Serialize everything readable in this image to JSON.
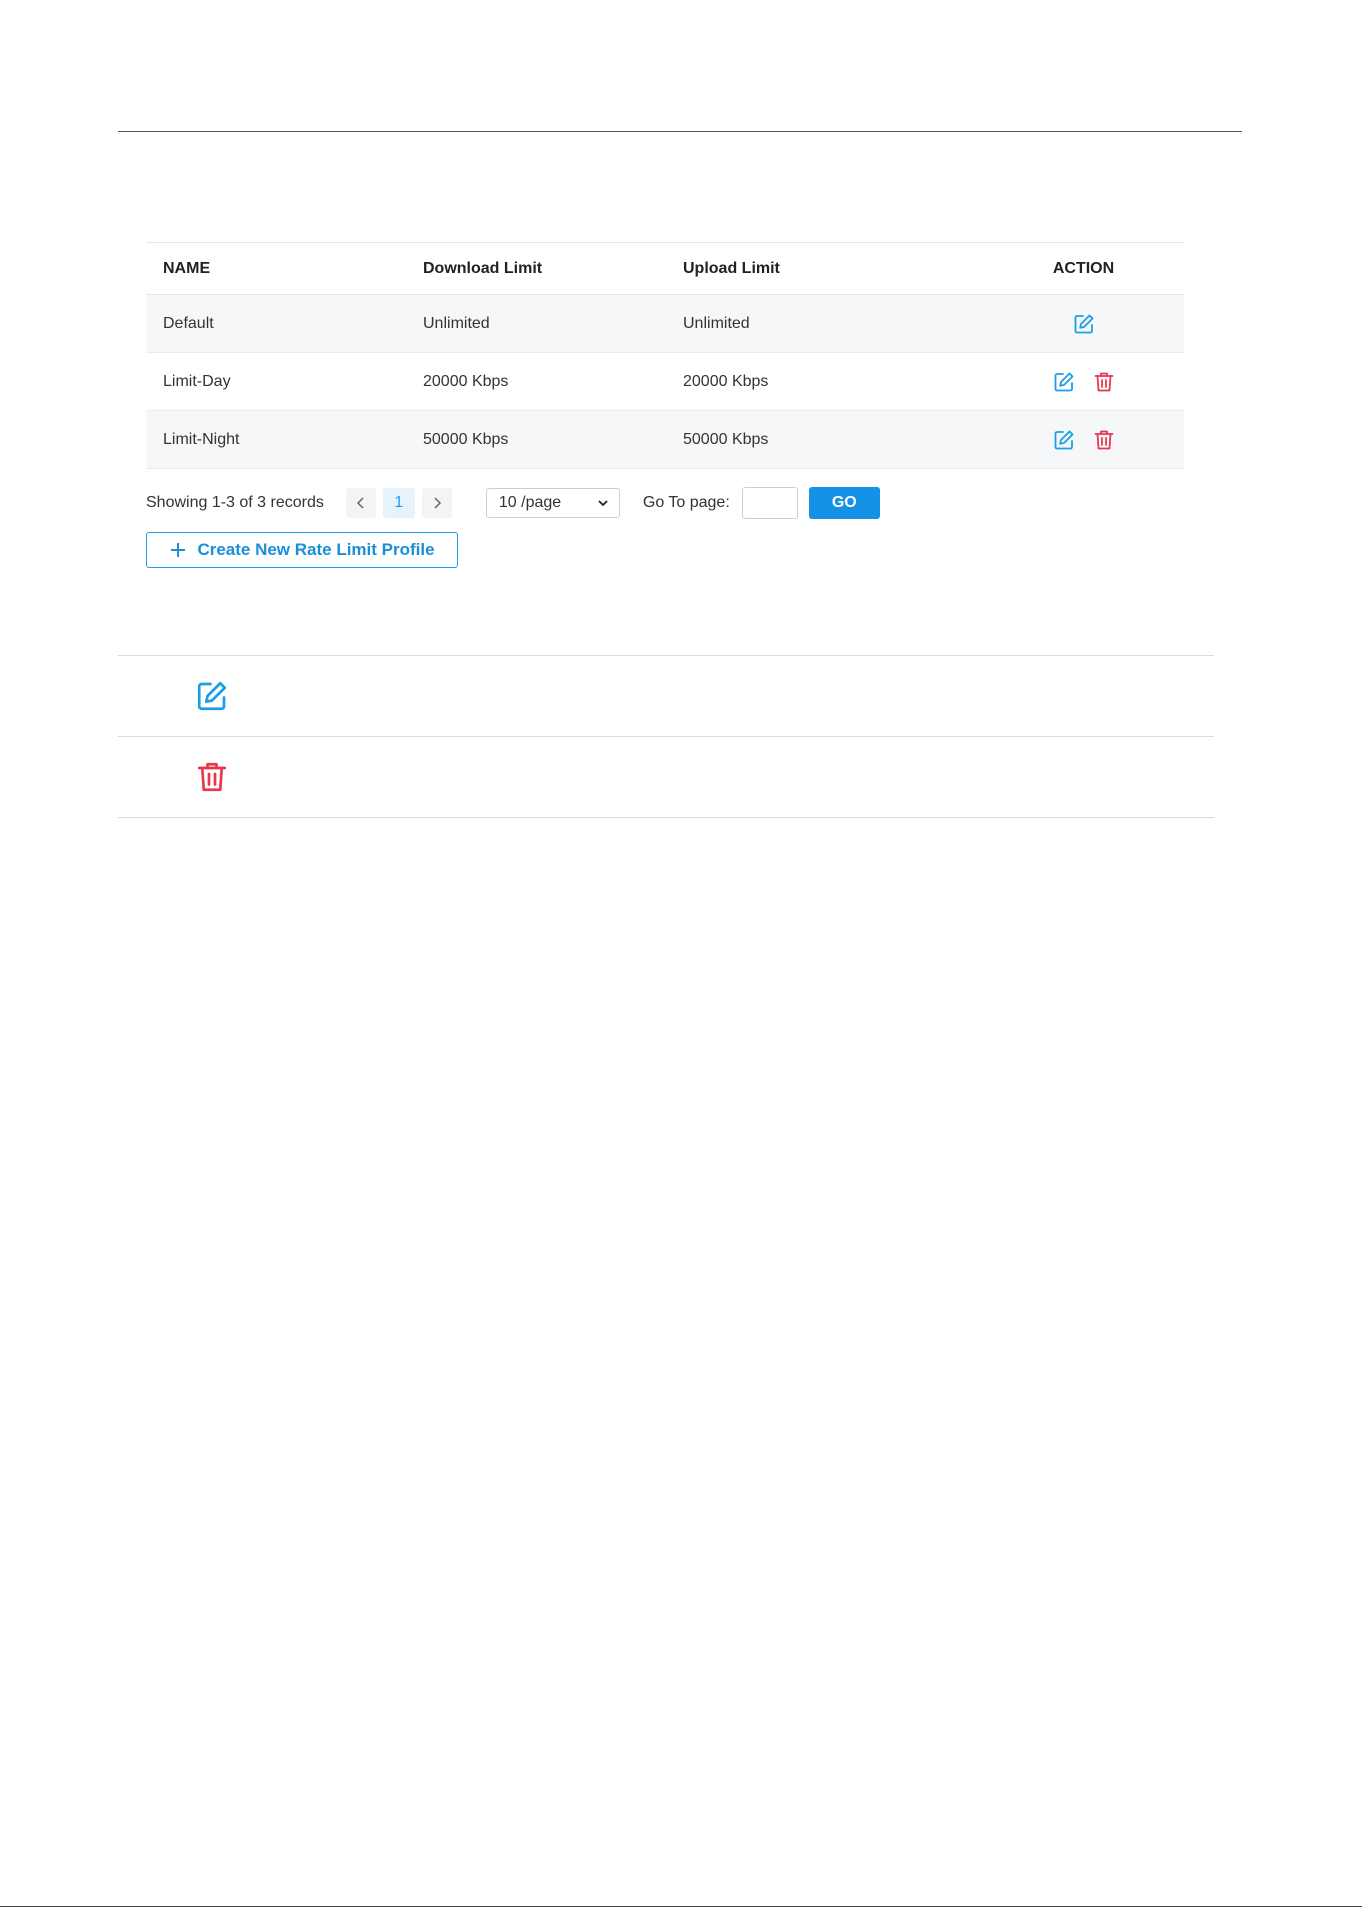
{
  "table": {
    "headers": {
      "name": "NAME",
      "download": "Download Limit",
      "upload": "Upload Limit",
      "action": "ACTION"
    },
    "rows": [
      {
        "name": "Default",
        "download": "Unlimited",
        "upload": "Unlimited",
        "actions": [
          "edit-icon"
        ]
      },
      {
        "name": "Limit-Day",
        "download": "20000 Kbps",
        "upload": "20000 Kbps",
        "actions": [
          "edit-icon",
          "delete-icon"
        ]
      },
      {
        "name": "Limit-Night",
        "download": "50000 Kbps",
        "upload": "50000 Kbps",
        "actions": [
          "edit-icon",
          "delete-icon"
        ]
      }
    ]
  },
  "pagination": {
    "summary": "Showing 1-3 of 3 records",
    "current_page": "1",
    "page_size": "10 /page",
    "goto_label": "Go To page:",
    "goto_value": "",
    "go_label": "GO"
  },
  "create_button": {
    "label": "Create New Rate Limit Profile",
    "icon": "plus-icon"
  },
  "legend": [
    {
      "icon": "edit-icon"
    },
    {
      "icon": "delete-icon"
    }
  ],
  "colors": {
    "accent": "#1a9fe8",
    "go_button": "#1592e6",
    "delete": "#e8364f",
    "stripe": "#f6f7f9"
  }
}
